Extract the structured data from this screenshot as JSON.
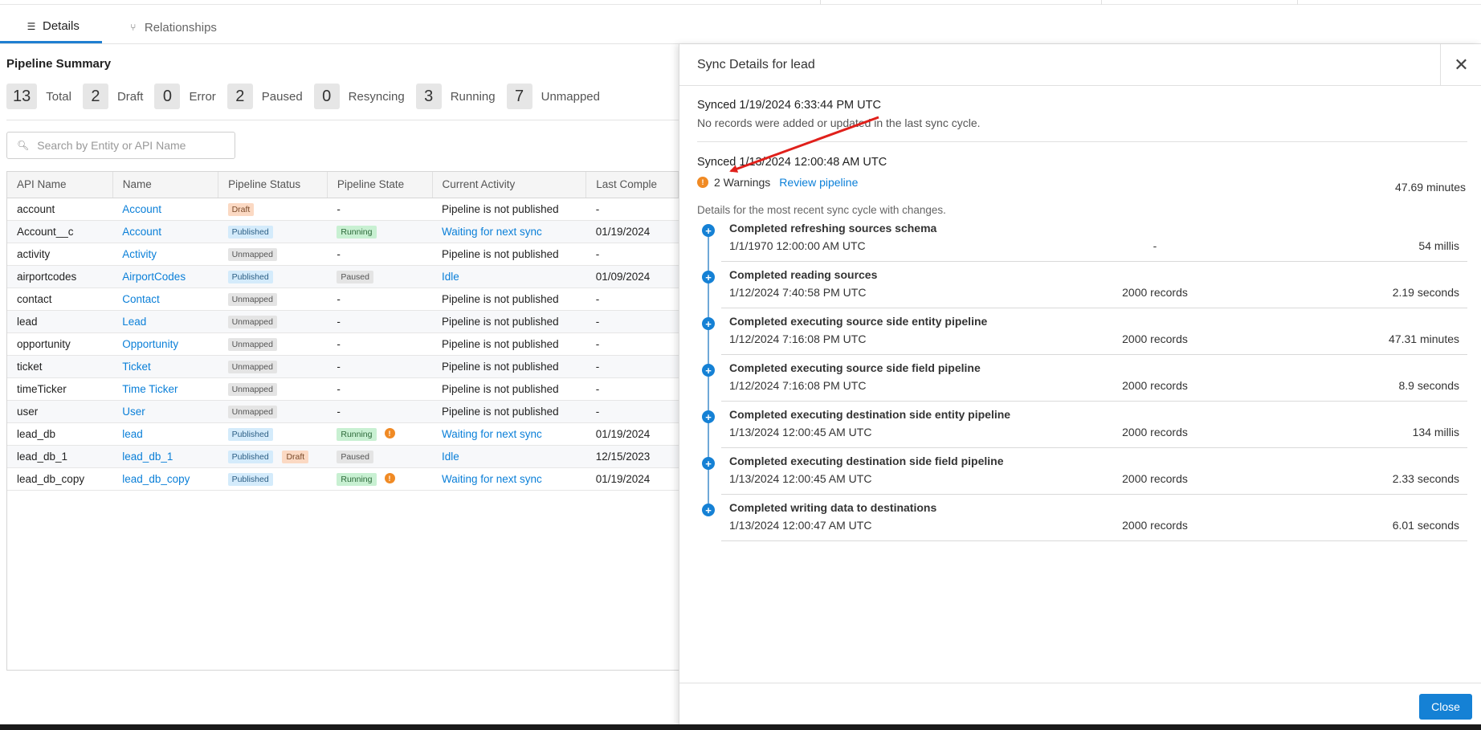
{
  "tabs": [
    {
      "label": "Details",
      "icon": "list-icon",
      "active": true
    },
    {
      "label": "Relationships",
      "icon": "fork-icon",
      "active": false
    }
  ],
  "summary": {
    "title": "Pipeline Summary",
    "stats": [
      {
        "value": "13",
        "label": "Total"
      },
      {
        "value": "2",
        "label": "Draft"
      },
      {
        "value": "0",
        "label": "Error"
      },
      {
        "value": "2",
        "label": "Paused"
      },
      {
        "value": "0",
        "label": "Resyncing"
      },
      {
        "value": "3",
        "label": "Running"
      },
      {
        "value": "7",
        "label": "Unmapped"
      }
    ]
  },
  "search": {
    "placeholder": "Search by Entity or API Name"
  },
  "table": {
    "headers": [
      "API Name",
      "Name",
      "Pipeline Status",
      "Pipeline State",
      "Current Activity",
      "Last Comple"
    ],
    "rows": [
      {
        "api": "account",
        "name": "Account",
        "status": "Draft",
        "status2": "",
        "state": "-",
        "warn": false,
        "activity": "Pipeline is not published",
        "last": "-"
      },
      {
        "api": "Account__c",
        "name": "Account",
        "status": "Published",
        "status2": "",
        "state": "Running",
        "warn": false,
        "activity": "Waiting for next sync",
        "last": "01/19/2024"
      },
      {
        "api": "activity",
        "name": "Activity",
        "status": "Unmapped",
        "status2": "",
        "state": "-",
        "warn": false,
        "activity": "Pipeline is not published",
        "last": "-"
      },
      {
        "api": "airportcodes",
        "name": "AirportCodes",
        "status": "Published",
        "status2": "",
        "state": "Paused",
        "warn": false,
        "activity": "Idle",
        "last": "01/09/2024"
      },
      {
        "api": "contact",
        "name": "Contact",
        "status": "Unmapped",
        "status2": "",
        "state": "-",
        "warn": false,
        "activity": "Pipeline is not published",
        "last": "-"
      },
      {
        "api": "lead",
        "name": "Lead",
        "status": "Unmapped",
        "status2": "",
        "state": "-",
        "warn": false,
        "activity": "Pipeline is not published",
        "last": "-"
      },
      {
        "api": "opportunity",
        "name": "Opportunity",
        "status": "Unmapped",
        "status2": "",
        "state": "-",
        "warn": false,
        "activity": "Pipeline is not published",
        "last": "-"
      },
      {
        "api": "ticket",
        "name": "Ticket",
        "status": "Unmapped",
        "status2": "",
        "state": "-",
        "warn": false,
        "activity": "Pipeline is not published",
        "last": "-"
      },
      {
        "api": "timeTicker",
        "name": "Time Ticker",
        "status": "Unmapped",
        "status2": "",
        "state": "-",
        "warn": false,
        "activity": "Pipeline is not published",
        "last": "-"
      },
      {
        "api": "user",
        "name": "User",
        "status": "Unmapped",
        "status2": "",
        "state": "-",
        "warn": false,
        "activity": "Pipeline is not published",
        "last": "-"
      },
      {
        "api": "lead_db",
        "name": "lead",
        "status": "Published",
        "status2": "",
        "state": "Running",
        "warn": true,
        "activity": "Waiting for next sync",
        "last": "01/19/2024"
      },
      {
        "api": "lead_db_1",
        "name": "lead_db_1",
        "status": "Published",
        "status2": "Draft",
        "state": "Paused",
        "warn": false,
        "activity": "Idle",
        "last": "12/15/2023"
      },
      {
        "api": "lead_db_copy",
        "name": "lead_db_copy",
        "status": "Published",
        "status2": "",
        "state": "Running",
        "warn": true,
        "activity": "Waiting for next sync",
        "last": "01/19/2024"
      }
    ]
  },
  "drawer": {
    "title": "Sync Details for lead",
    "close_label": "Close",
    "sync1": {
      "title": "Synced 1/19/2024 6:33:44 PM UTC",
      "message": "No records were added or updated in the last sync cycle."
    },
    "sync2": {
      "title": "Synced 1/13/2024 12:00:48 AM UTC",
      "warnings": "2 Warnings",
      "review": "Review pipeline",
      "duration": "47.69 minutes"
    },
    "details_note": "Details for the most recent sync cycle with changes.",
    "steps": [
      {
        "title": "Completed refreshing sources schema",
        "time": "1/1/1970 12:00:00 AM UTC",
        "records": "-",
        "duration": "54 millis"
      },
      {
        "title": "Completed reading sources",
        "time": "1/12/2024 7:40:58 PM UTC",
        "records": "2000 records",
        "duration": "2.19 seconds"
      },
      {
        "title": "Completed executing source side entity pipeline",
        "time": "1/12/2024 7:16:08 PM UTC",
        "records": "2000 records",
        "duration": "47.31 minutes"
      },
      {
        "title": "Completed executing source side field pipeline",
        "time": "1/12/2024 7:16:08 PM UTC",
        "records": "2000 records",
        "duration": "8.9 seconds"
      },
      {
        "title": "Completed executing destination side entity pipeline",
        "time": "1/13/2024 12:00:45 AM UTC",
        "records": "2000 records",
        "duration": "134 millis"
      },
      {
        "title": "Completed executing destination side field pipeline",
        "time": "1/13/2024 12:00:45 AM UTC",
        "records": "2000 records",
        "duration": "2.33 seconds"
      },
      {
        "title": "Completed writing data to destinations",
        "time": "1/13/2024 12:00:47 AM UTC",
        "records": "2000 records",
        "duration": "6.01 seconds"
      }
    ]
  },
  "colors": {
    "accent": "#1581d5",
    "link": "#0a7fd8",
    "warning": "#f08a24",
    "annotation_arrow": "#e0201b"
  }
}
